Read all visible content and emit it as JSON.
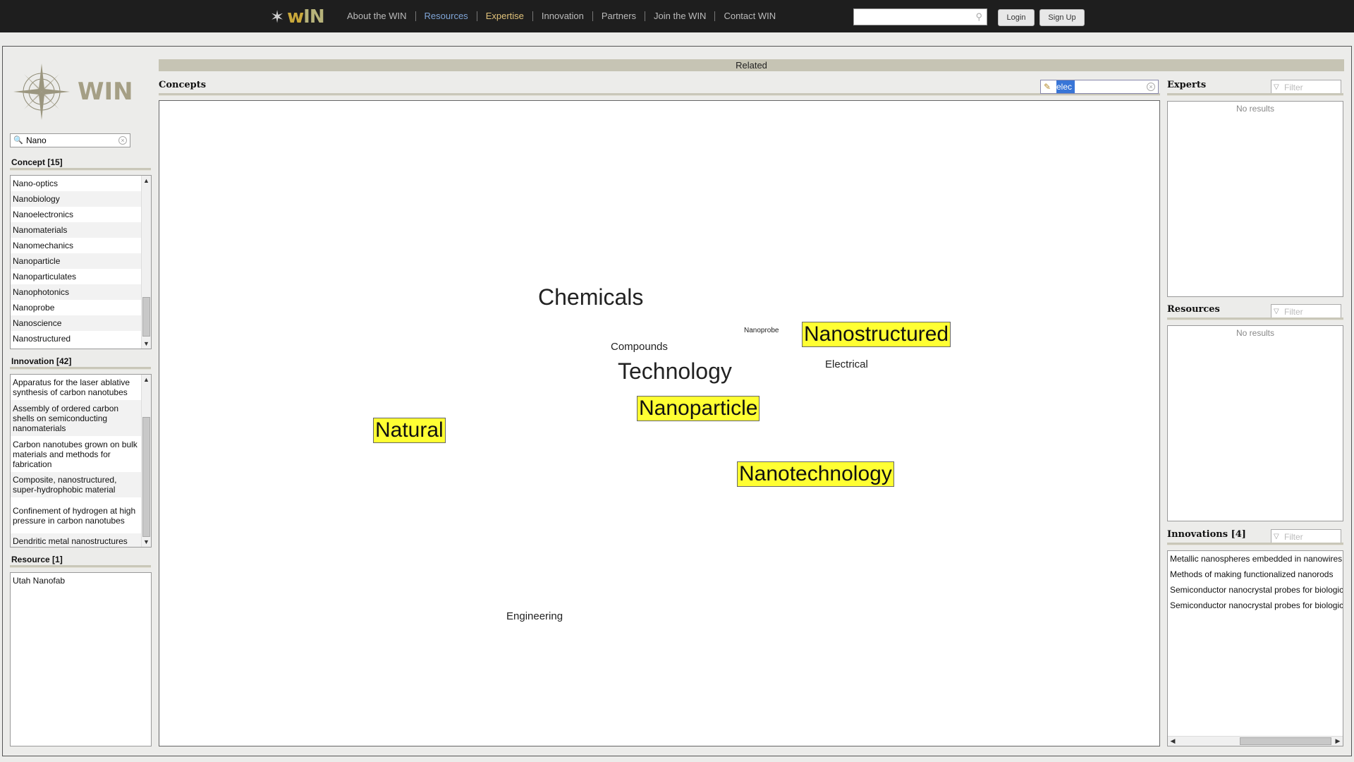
{
  "header": {
    "logo_w": "w",
    "logo_in": "IN",
    "nav": [
      "About the WIN",
      "Resources",
      "Expertise",
      "Innovation",
      "Partners",
      "Join the WIN",
      "Contact WIN"
    ],
    "search_value": "",
    "login_label": "Login",
    "signup_label": "Sign Up"
  },
  "left": {
    "logo_word": "WIN",
    "search_value": "Nano",
    "concept_title": "Concept [15]",
    "concepts": [
      "Nano-optics",
      "Nanobiology",
      "Nanoelectronics",
      "Nanomaterials",
      "Nanomechanics",
      "Nanoparticle",
      "Nanoparticulates",
      "Nanophotonics",
      "Nanoprobe",
      "Nanoscience",
      "Nanostructured"
    ],
    "innovation_title": "Innovation [42]",
    "innovations": [
      "Apparatus for the laser ablative synthesis of carbon nanotubes",
      "Assembly of ordered carbon shells on semiconducting nanomaterials",
      "Carbon nanotubes grown on bulk materials and methods for fabrication",
      "Composite, nanostructured, super-hydrophobic material",
      "Confinement of hydrogen at high pressure in carbon nanotubes",
      "Dendritic metal nanostructures"
    ],
    "resource_title": "Resource [1]",
    "resources": [
      "Utah Nanofab"
    ]
  },
  "center": {
    "related_label": "Related",
    "concepts_label": "Concepts",
    "concept_search": "elec",
    "cloud": [
      "Chemicals",
      "Compounds",
      "Nanoprobe",
      "Nanostructured",
      "Electrical",
      "Technology",
      "Nanoparticle",
      "Natural",
      "Nanotechnology",
      "Engineering"
    ]
  },
  "right": {
    "experts_title": "Experts",
    "experts_filter_placeholder": "Filter",
    "experts_empty": "No results",
    "resources_title": "Resources",
    "resources_filter_placeholder": "Filter",
    "resources_empty": "No results",
    "innovations_title": "Innovations [4]",
    "innovations_filter_placeholder": "Filter",
    "innovations": [
      "Metallic nanospheres embedded in nanowires",
      "Methods of making functionalized nanorods",
      "Semiconductor nanocrystal probes for biological applications",
      "Semiconductor nanocrystal probes for biological applications"
    ]
  },
  "colors": {
    "highlight": "#ffff33",
    "nav_active_blue": "#7fa4d6",
    "nav_gold": "#e0c27a",
    "topbar": "#1e1e1e",
    "section_bar": "#c6c4b4"
  },
  "icons": [
    "compass-star-icon",
    "search-icon",
    "clear-icon",
    "pencil-icon",
    "filter-icon",
    "scroll-up-icon",
    "scroll-down-icon",
    "scroll-left-icon",
    "scroll-right-icon"
  ]
}
